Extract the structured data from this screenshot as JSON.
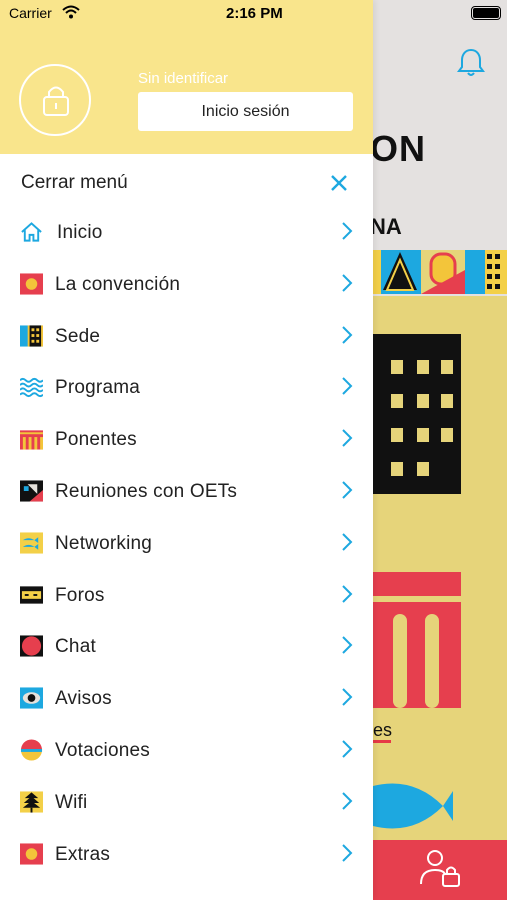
{
  "status_bar": {
    "carrier": "Carrier",
    "time": "2:16 PM"
  },
  "background": {
    "title_fragment": "ON",
    "subtitle_fragment": "NA",
    "link_fragment": "es"
  },
  "drawer": {
    "guest_label": "Sin identificar",
    "login_label": "Inicio sesión",
    "close_label": "Cerrar menú",
    "items": [
      {
        "label": "Inicio",
        "icon": "home-icon"
      },
      {
        "label": "La convención",
        "icon": "convention-icon"
      },
      {
        "label": "Sede",
        "icon": "venue-icon"
      },
      {
        "label": "Programa",
        "icon": "program-icon"
      },
      {
        "label": "Ponentes",
        "icon": "speakers-icon"
      },
      {
        "label": "Reuniones con OETs",
        "icon": "meetings-icon"
      },
      {
        "label": "Networking",
        "icon": "networking-icon"
      },
      {
        "label": "Foros",
        "icon": "forums-icon"
      },
      {
        "label": "Chat",
        "icon": "chat-icon"
      },
      {
        "label": "Avisos",
        "icon": "notices-icon"
      },
      {
        "label": "Votaciones",
        "icon": "votes-icon"
      },
      {
        "label": "Wifi",
        "icon": "wifi-icon"
      },
      {
        "label": "Extras",
        "icon": "extras-icon"
      }
    ]
  },
  "colors": {
    "header_yellow": "#f9e58c",
    "accent_blue": "#1da8e0",
    "accent_red": "#e63f4e"
  }
}
